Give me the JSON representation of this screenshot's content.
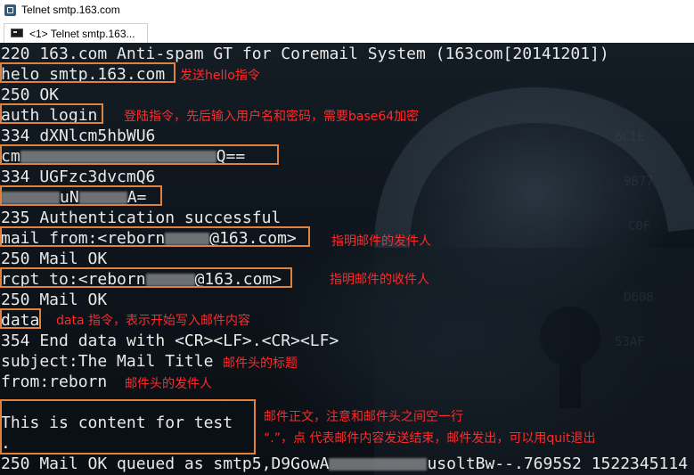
{
  "window": {
    "title": "Telnet smtp.163.com"
  },
  "tab": {
    "label": "<1> Telnet smtp.163...",
    "icon": "console-icon"
  },
  "console": {
    "lines": [
      "220 163.com Anti-spam GT for Coremail System (163com[20141201])",
      "helo smtp.163.com",
      "250 OK",
      "auth login",
      "334 dXNlcm5hbWU6",
      "cm",
      "Q==",
      "334 UGFzc3dvcmQ6",
      "uN",
      "A=",
      "235 Authentication successful",
      "mail from:<reborn",
      "@163.com>",
      "250 Mail OK",
      "rcpt to:<reborn",
      "@163.com>",
      "250 Mail OK",
      "data",
      "354 End data with <CR><LF>.<CR><LF>",
      "subject:The Mail Title",
      "from:reborn",
      "This is content for test",
      ".",
      "250 Mail OK queued as smtp5,D9GowA",
      "usoltBw--.7695S2 1522345114"
    ]
  },
  "notes": {
    "helo": "发送hello指令",
    "auth": "登陆指令，先后输入用户名和密码，需要base64加密",
    "mail_from": "指明邮件的发件人",
    "rcpt_to": "指明邮件的收件人",
    "data": "data 指令，表示开始写入邮件内容",
    "subject": "邮件头的标题",
    "from": "邮件头的发件人",
    "body_1": "邮件正文，注意和邮件头之间空一行",
    "body_2": "“.”，点 代表邮件内容发送结束，邮件发出，可以用quit退出"
  },
  "colors": {
    "annotation": "#ff2a2a",
    "box": "#e0823e",
    "console_text": "#eaeaea"
  }
}
